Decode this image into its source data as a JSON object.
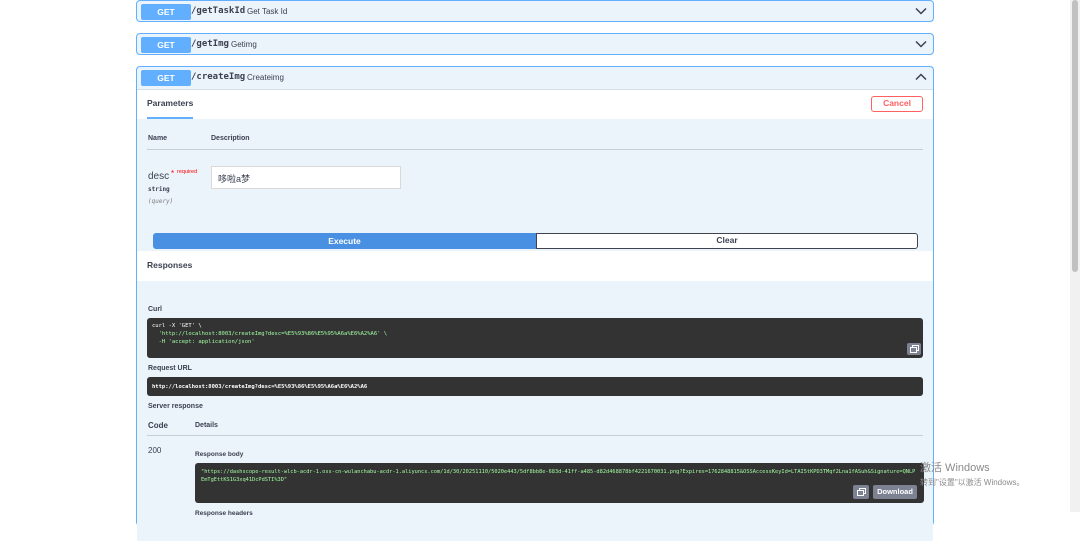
{
  "ops": [
    {
      "method": "GET",
      "path": "/getTaskId",
      "summary": "Get Task Id"
    },
    {
      "method": "GET",
      "path": "/getImg",
      "summary": "Getimg"
    },
    {
      "method": "GET",
      "path": "/createImg",
      "summary": "Createimg"
    }
  ],
  "parameters": {
    "tab_label": "Parameters",
    "cancel_label": "Cancel",
    "col_name": "Name",
    "col_description": "Description",
    "param": {
      "name": "desc",
      "required_star": "*",
      "required_label": "required",
      "type": "string",
      "location": "(query)",
      "value": "哆啦a梦"
    },
    "execute_label": "Execute",
    "clear_label": "Clear"
  },
  "responses": {
    "title": "Responses",
    "curl_label": "Curl",
    "curl_line1": "curl -X 'GET' \\",
    "curl_line2": "  'http://localhost:8003/createImg?desc=%E5%93%86%E5%95%A6a%E6%A2%A6' \\",
    "curl_line3": "  -H 'accept: application/json'",
    "request_url_label": "Request URL",
    "request_url": "http://localhost:8003/createImg?desc=%E5%93%86%E5%95%A6a%E6%A2%A6",
    "server_response_label": "Server response",
    "code_header": "Code",
    "details_header": "Details",
    "status_code": "200",
    "body_label": "Response body",
    "body": "\"https://dashscope-result-wlcb-acdr-1.oss-cn-wulanchabu-acdr-1.aliyuncs.com/1d/30/20251110/5020e443/5df8bb8e-683d-41ff-a485-d82d468878bf4221670031.png?Expires=1762848815&OSSAccessKeyId=LTAI5tKPD3TMqf2Lna1fASuh&Signature=QNLPEmTgEttKS1G3xq41DcPdSTI%3D\"",
    "download_label": "Download",
    "headers_label": "Response headers"
  },
  "watermark": {
    "line1": "激活 Windows",
    "line2": "转到\"设置\"以激活 Windows。"
  }
}
